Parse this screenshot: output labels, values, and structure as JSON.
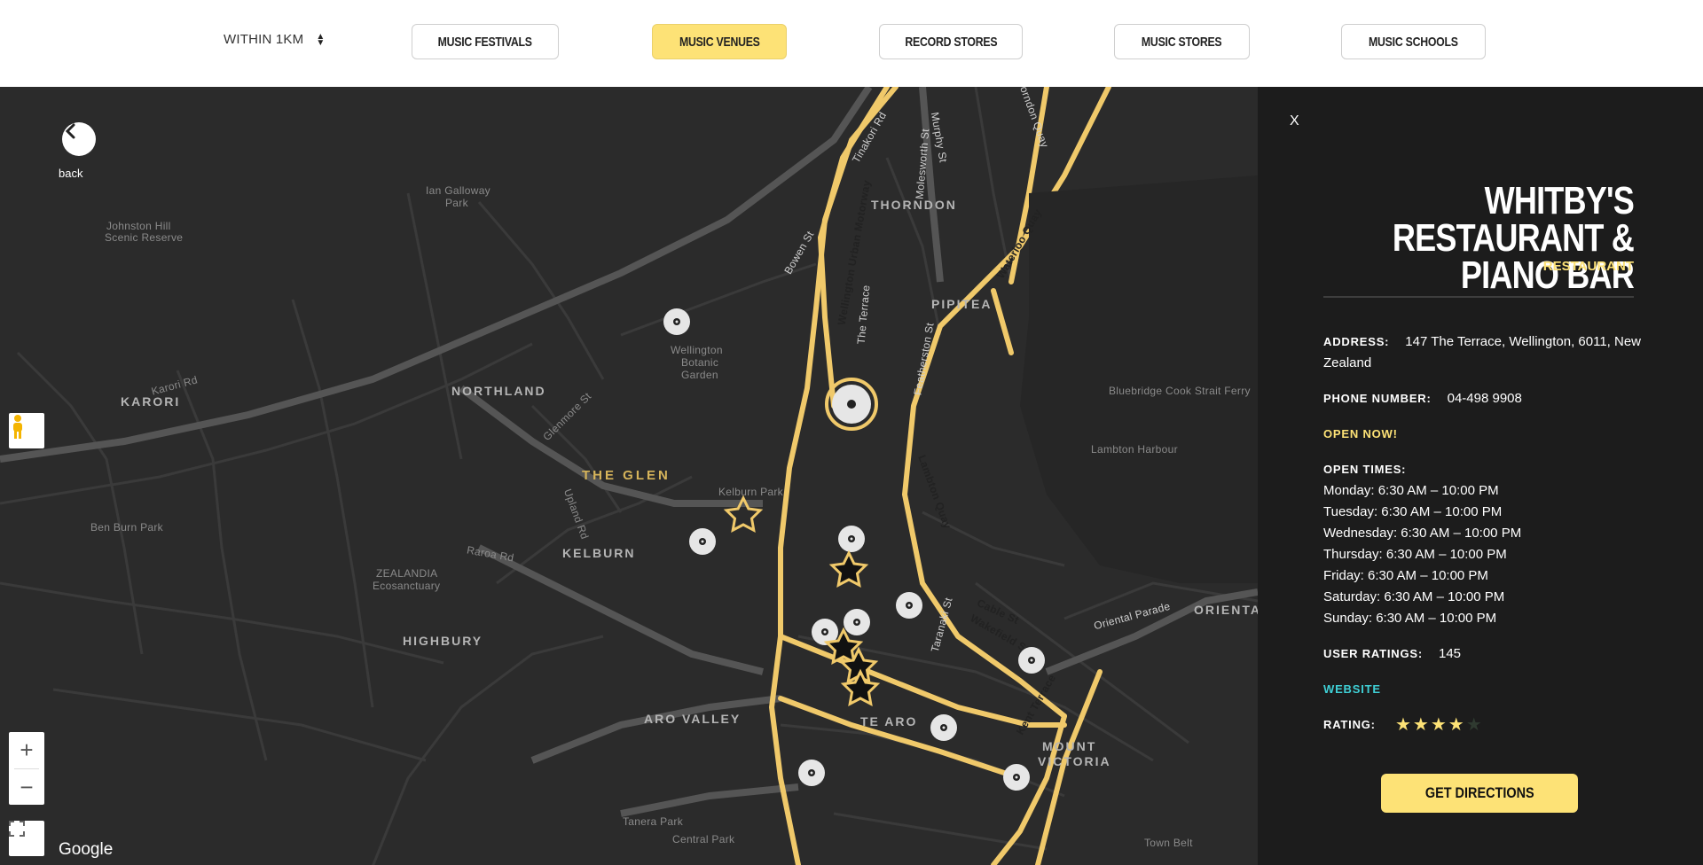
{
  "filters": {
    "distance": "WITHIN 1KM",
    "buttons": [
      {
        "label": "Music Festivals",
        "active": false
      },
      {
        "label": "Music Venues",
        "active": true
      },
      {
        "label": "Record Stores",
        "active": false
      },
      {
        "label": "Music Stores",
        "active": false
      },
      {
        "label": "Music Schools",
        "active": false
      }
    ]
  },
  "map": {
    "back_label": "back",
    "attribution": "Google",
    "zoom_in": "+",
    "zoom_out": "−",
    "suburbs": [
      "KARORI",
      "NORTHLAND",
      "THE GLEN",
      "KELBURN",
      "HIGHBURY",
      "ARO VALLEY",
      "TE ARO",
      "MOUNT",
      "VICTORIA",
      "THORNDON",
      "PIPITEA",
      "ORIENTA"
    ],
    "places": [
      "Johnston Hill",
      "Scenic Reserve",
      "Ian Galloway",
      "Park",
      "Wellington",
      "Botanic",
      "Garden",
      "Kelburn Park",
      "ZEALANDIA",
      "Ecosanctuary",
      "Ben Burn Park",
      "Central Park",
      "Tanera Park",
      "Town Belt",
      "Bluebridge Cook Strait Ferry",
      "Lambton Harbour"
    ],
    "streets": [
      "Karori Rd",
      "Glenmore St",
      "Upland Rd",
      "Raroa Rd",
      "Wellington Urban Motorway",
      "The Terrace",
      "Featherston St",
      "Waterloo Quay",
      "Lambton Quay",
      "Cable St",
      "Wakefield St",
      "Kent Terrace",
      "Oriental Parade",
      "Tinakori Rd",
      "Murphy St",
      "Bowen St",
      "Molesworth St",
      "Thorndon Quay",
      "Taranaki St"
    ],
    "accent": "#f0c96a"
  },
  "panel": {
    "close": "X",
    "name": "WHITBY'S RESTAURANT & PIANO BAR",
    "type": "RESTAURANT",
    "address_label": "ADDRESS:",
    "address": "147 The Terrace, Wellington, 6011, New Zealand",
    "phone_label": "PHONE NUMBER:",
    "phone": "04-498 9908",
    "open_now": "OPEN NOW!",
    "open_times_label": "OPEN TIMES:",
    "hours": [
      "Monday: 6:30 AM – 10:00 PM",
      "Tuesday: 6:30 AM – 10:00 PM",
      "Wednesday: 6:30 AM – 10:00 PM",
      "Thursday: 6:30 AM – 10:00 PM",
      "Friday: 6:30 AM – 10:00 PM",
      "Saturday: 6:30 AM – 10:00 PM",
      "Sunday: 6:30 AM – 10:00 PM"
    ],
    "ratings_label": "USER RATINGS:",
    "ratings_count": "145",
    "website": "WEBSITE",
    "rating_label": "RATING:",
    "rating_value": 4,
    "rating_max": 5,
    "directions": "GET DIRECTIONS",
    "accent": "#fde276",
    "link_color": "#3fd0d6"
  }
}
